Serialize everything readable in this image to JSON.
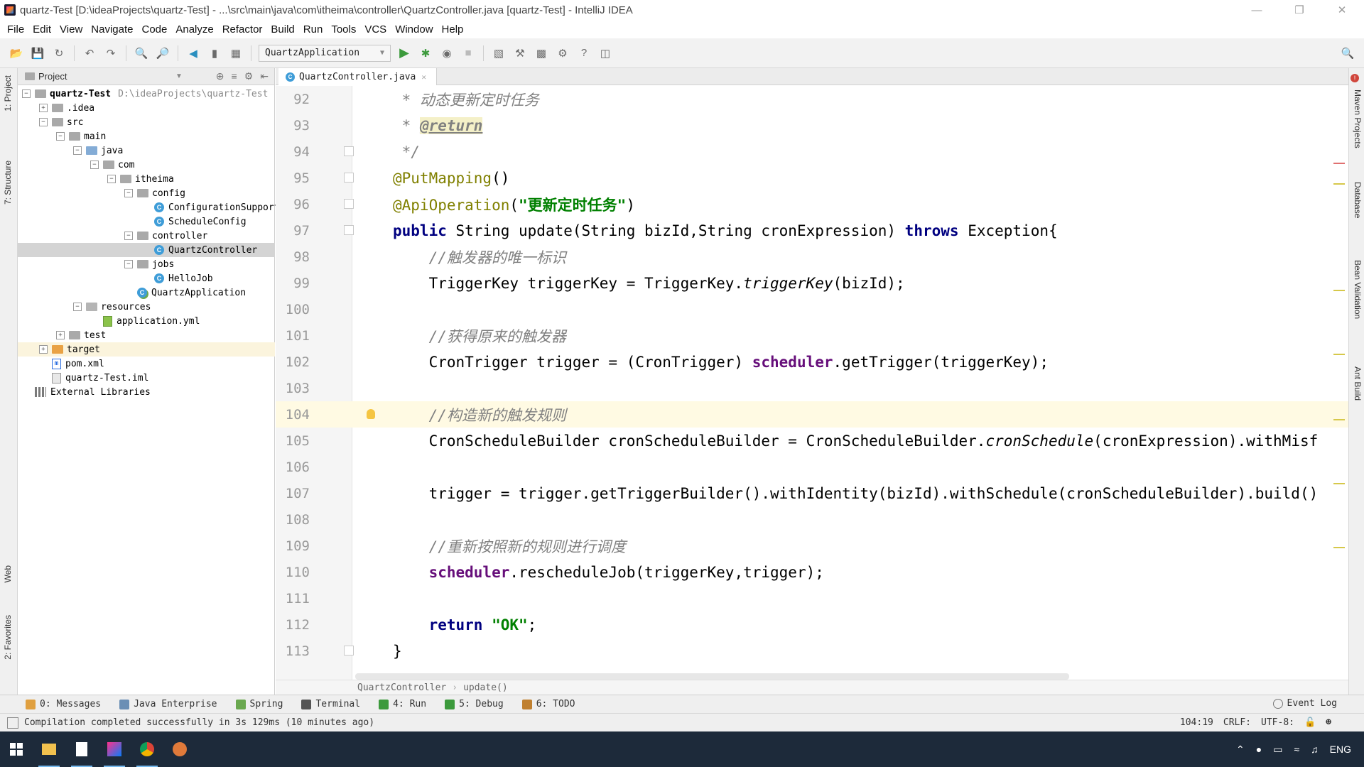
{
  "window": {
    "title": "quartz-Test [D:\\ideaProjects\\quartz-Test] - ...\\src\\main\\java\\com\\itheima\\controller\\QuartzController.java [quartz-Test] - IntelliJ IDEA",
    "controls": [
      "minimize",
      "maximize",
      "close"
    ]
  },
  "menu": [
    "File",
    "Edit",
    "View",
    "Navigate",
    "Code",
    "Analyze",
    "Refactor",
    "Build",
    "Run",
    "Tools",
    "VCS",
    "Window",
    "Help"
  ],
  "toolbar": {
    "run_config": "QuartzApplication",
    "icons": [
      "open-folder-icon",
      "save-icon",
      "sync-icon",
      "undo-icon",
      "redo-icon",
      "find-icon",
      "replace-icon",
      "back-icon",
      "forward-icon",
      "build-icon",
      "run-icon",
      "debug-icon",
      "coverage-icon",
      "stop-icon",
      "attach-icon",
      "vcs-icon",
      "structure-icon",
      "settings-icon",
      "help-icon",
      "update-icon",
      "search-icon"
    ]
  },
  "left_strip": {
    "tabs": [
      "1: Project",
      "7: Structure",
      "Web",
      "2: Favorites"
    ]
  },
  "project": {
    "header": "Project",
    "tree": [
      {
        "label": "quartz-Test",
        "extra": "D:\\ideaProjects\\quartz-Test",
        "type": "module",
        "indent": 0,
        "toggle": "-"
      },
      {
        "label": ".idea",
        "type": "folder",
        "indent": 1,
        "toggle": "+"
      },
      {
        "label": "src",
        "type": "folder",
        "indent": 1,
        "toggle": "-"
      },
      {
        "label": "main",
        "type": "folder",
        "indent": 2,
        "toggle": "-"
      },
      {
        "label": "java",
        "type": "folder-blue",
        "indent": 3,
        "toggle": "-"
      },
      {
        "label": "com",
        "type": "folder",
        "indent": 4,
        "toggle": "-"
      },
      {
        "label": "itheima",
        "type": "folder",
        "indent": 5,
        "toggle": "-"
      },
      {
        "label": "config",
        "type": "folder",
        "indent": 6,
        "toggle": "-"
      },
      {
        "label": "ConfigurationSupport",
        "type": "class",
        "indent": 7,
        "toggle": ""
      },
      {
        "label": "ScheduleConfig",
        "type": "class",
        "indent": 7,
        "toggle": ""
      },
      {
        "label": "controller",
        "type": "folder",
        "indent": 6,
        "toggle": "-"
      },
      {
        "label": "QuartzController",
        "type": "class",
        "indent": 7,
        "toggle": "",
        "selected": true
      },
      {
        "label": "jobs",
        "type": "folder",
        "indent": 6,
        "toggle": "-"
      },
      {
        "label": "HelloJob",
        "type": "class",
        "indent": 7,
        "toggle": ""
      },
      {
        "label": "QuartzApplication",
        "type": "class-app",
        "indent": 6,
        "toggle": ""
      },
      {
        "label": "resources",
        "type": "folder-res",
        "indent": 3,
        "toggle": "-"
      },
      {
        "label": "application.yml",
        "type": "file-yml",
        "indent": 4,
        "toggle": ""
      },
      {
        "label": "test",
        "type": "folder",
        "indent": 2,
        "toggle": "+"
      },
      {
        "label": "target",
        "type": "folder-orange",
        "indent": 1,
        "toggle": "+",
        "target": true
      },
      {
        "label": "pom.xml",
        "type": "file-m",
        "indent": 1,
        "toggle": ""
      },
      {
        "label": "quartz-Test.iml",
        "type": "file",
        "indent": 1,
        "toggle": ""
      },
      {
        "label": "External Libraries",
        "type": "lib",
        "indent": 0,
        "toggle": ""
      }
    ]
  },
  "editor": {
    "tab": "QuartzController.java",
    "caret_line": 104,
    "lines": [
      {
        "n": "92",
        "segs": [
          [
            "c-comment",
            " * 动态更新定时任务"
          ]
        ]
      },
      {
        "n": "93",
        "segs": [
          [
            "c-comment",
            " * "
          ],
          [
            "c-tag",
            "@return"
          ]
        ]
      },
      {
        "n": "94",
        "segs": [
          [
            "c-comment",
            " */"
          ]
        ]
      },
      {
        "n": "95",
        "segs": [
          [
            "c-anno",
            "@PutMapping"
          ],
          [
            "",
            "()"
          ]
        ]
      },
      {
        "n": "96",
        "segs": [
          [
            "c-anno",
            "@ApiOperation"
          ],
          [
            "",
            "("
          ],
          [
            "c-str",
            "\"更新定时任务\""
          ],
          [
            "",
            ")"
          ]
        ]
      },
      {
        "n": "97",
        "segs": [
          [
            "c-kw",
            "public "
          ],
          [
            "",
            "String update(String bizId,String cronExpression) "
          ],
          [
            "c-kw",
            "throws "
          ],
          [
            "",
            "Exception{"
          ]
        ]
      },
      {
        "n": "98",
        "segs": [
          [
            "c-comment",
            "    //触发器的唯一标识"
          ]
        ]
      },
      {
        "n": "99",
        "segs": [
          [
            "",
            "    TriggerKey triggerKey = TriggerKey."
          ],
          [
            "c-static",
            "triggerKey"
          ],
          [
            "",
            "(bizId);"
          ]
        ]
      },
      {
        "n": "100",
        "segs": []
      },
      {
        "n": "101",
        "segs": [
          [
            "c-comment",
            "    //获得原来的触发器"
          ]
        ]
      },
      {
        "n": "102",
        "segs": [
          [
            "",
            "    CronTrigger trigger = (CronTrigger) "
          ],
          [
            "c-field",
            "scheduler"
          ],
          [
            "",
            ".getTrigger(triggerKey);"
          ]
        ]
      },
      {
        "n": "103",
        "segs": []
      },
      {
        "n": "104",
        "segs": [
          [
            "c-comment",
            "    //构造新的触发规则"
          ]
        ]
      },
      {
        "n": "105",
        "segs": [
          [
            "",
            "    CronScheduleBuilder cronScheduleBuilder = CronScheduleBuilder."
          ],
          [
            "c-static",
            "cronSchedule"
          ],
          [
            "",
            "(cronExpression).withMisf"
          ]
        ]
      },
      {
        "n": "106",
        "segs": []
      },
      {
        "n": "107",
        "segs": [
          [
            "",
            "    trigger = trigger.getTriggerBuilder().withIdentity(bizId).withSchedule(cronScheduleBuilder).build()"
          ]
        ]
      },
      {
        "n": "108",
        "segs": []
      },
      {
        "n": "109",
        "segs": [
          [
            "c-comment",
            "    //重新按照新的规则进行调度"
          ]
        ]
      },
      {
        "n": "110",
        "segs": [
          [
            "c-field",
            "    scheduler"
          ],
          [
            "",
            ".rescheduleJob(triggerKey,trigger);"
          ]
        ]
      },
      {
        "n": "111",
        "segs": []
      },
      {
        "n": "112",
        "segs": [
          [
            "c-kw",
            "    return "
          ],
          [
            "c-str",
            "\"OK\""
          ],
          [
            "",
            ";"
          ]
        ]
      },
      {
        "n": "113",
        "segs": [
          [
            "",
            "}"
          ]
        ]
      }
    ],
    "breadcrumb": [
      "QuartzController",
      "update()"
    ]
  },
  "right_strip": {
    "tabs": [
      "Maven Projects",
      "Database",
      "Bean Validation",
      "Ant Build"
    ]
  },
  "bottom_tools": [
    {
      "label": "0: Messages",
      "color": "#e0a040"
    },
    {
      "label": "Java Enterprise",
      "color": "#6b8fb5"
    },
    {
      "label": "Spring",
      "color": "#6aa84f"
    },
    {
      "label": "Terminal",
      "color": "#555555"
    },
    {
      "label": "4: Run",
      "color": "#3c9a3c"
    },
    {
      "label": "5: Debug",
      "color": "#3c9a3c"
    },
    {
      "label": "6: TODO",
      "color": "#c08030"
    }
  ],
  "event_log": "Event Log",
  "status": {
    "message": "Compilation completed successfully in 3s 129ms (10 minutes ago)",
    "position": "104:19",
    "line_sep": "CRLF:",
    "encoding": "UTF-8:"
  },
  "taskbar": {
    "lang": "ENG"
  }
}
